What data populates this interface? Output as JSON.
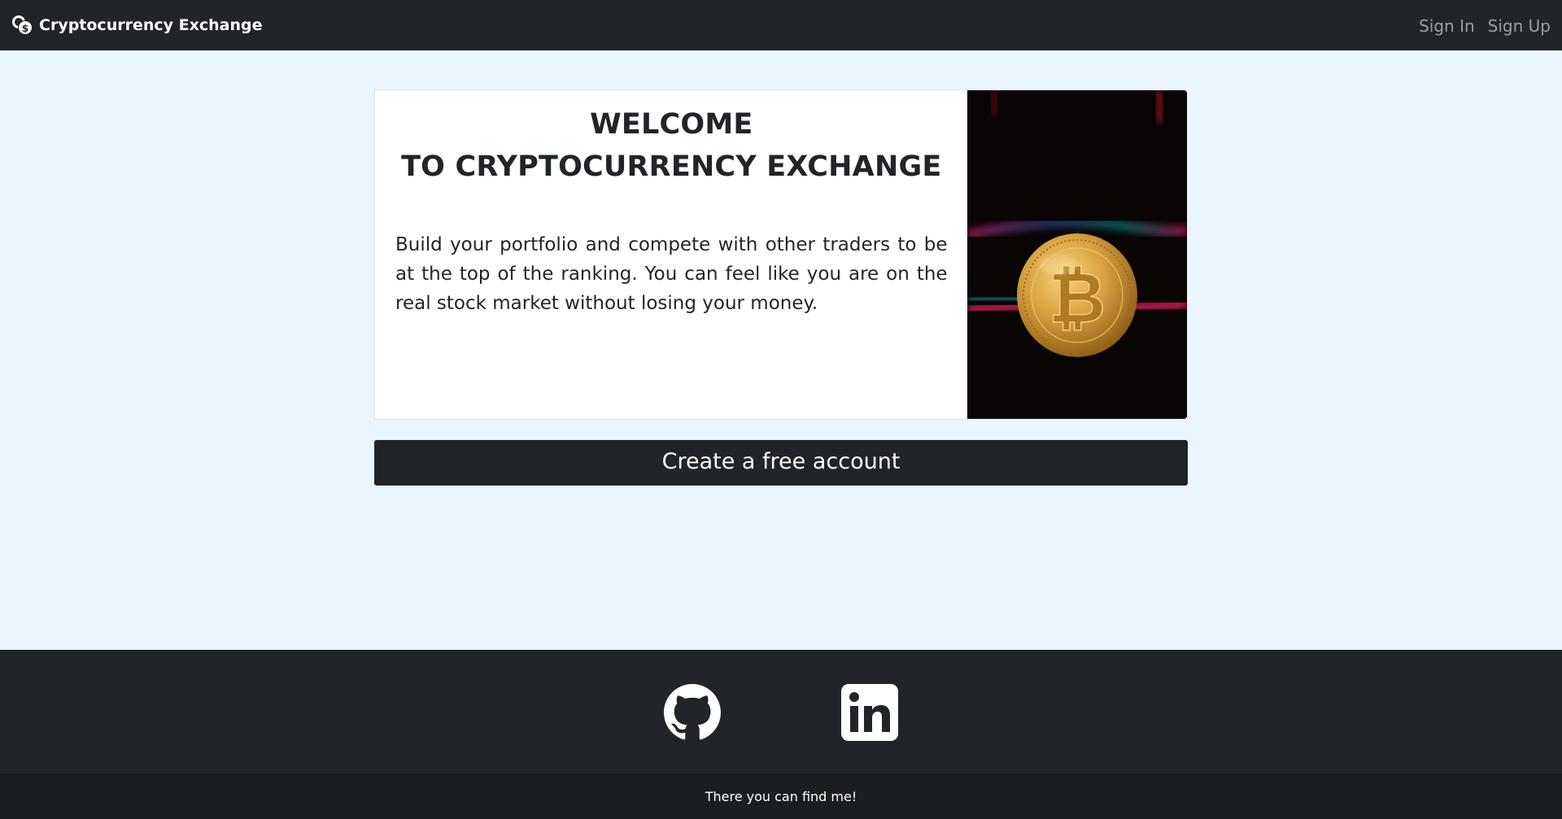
{
  "navbar": {
    "brand": "Cryptocurrency Exchange",
    "brand_icon": "coins-icon",
    "links": [
      {
        "label": "Sign In"
      },
      {
        "label": "Sign Up"
      }
    ]
  },
  "hero": {
    "title_line1": "WELCOME",
    "title_line2": "TO CRYPTOCURRENCY EXCHANGE",
    "description": "Build your portfolio and compete with other traders to be at the top of the ranking. You can feel like you are on the real stock market without losing your money.",
    "image": "bitcoin-coin-image"
  },
  "cta": {
    "label": "Create a free account"
  },
  "footer": {
    "social": [
      {
        "name": "github-icon"
      },
      {
        "name": "linkedin-icon"
      }
    ],
    "caption": "There you can find me!"
  },
  "colors": {
    "navbar_bg": "#212529",
    "page_bg": "#eaf5ff",
    "footer_bottom_bg": "#1b1e21"
  }
}
